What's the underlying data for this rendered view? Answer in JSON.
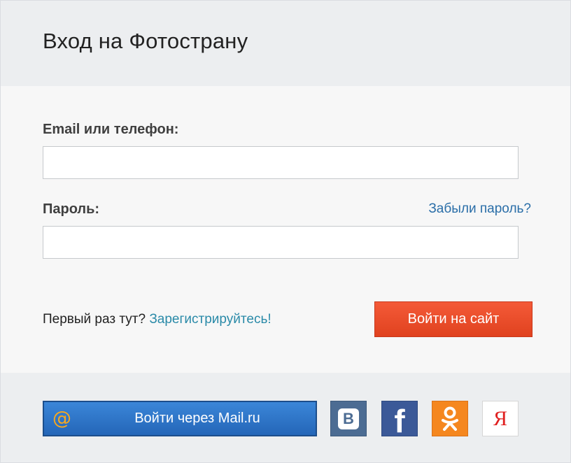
{
  "header": {
    "title": "Вход на Фотострану"
  },
  "form": {
    "email_label": "Email или телефон:",
    "email_value": "",
    "password_label": "Пароль:",
    "password_value": "",
    "forgot_link": "Забыли пароль?",
    "first_time_text": "Первый раз тут?",
    "register_link": "Зарегистрируйтесь!",
    "login_button": "Войти на сайт"
  },
  "social": {
    "mailru_icon_glyph": "@",
    "mailru_label": "Войти через Mail.ru",
    "vk_glyph": "В",
    "facebook_glyph": "f",
    "yandex_glyph": "Я",
    "icons": {
      "mailru": "mailru-icon",
      "vk": "vk-icon",
      "facebook": "facebook-icon",
      "odnoklassniki": "odnoklassniki-icon",
      "yandex": "yandex-icon"
    },
    "colors": {
      "mailru": "#2466b8",
      "vk": "#4c6c93",
      "facebook": "#3b5998",
      "odnoklassniki": "#f5871f",
      "yandex": "#e01f1f"
    }
  },
  "colors": {
    "login_button": "#e0421f",
    "link": "#2a6ea8",
    "header_bg": "#eceef0"
  }
}
